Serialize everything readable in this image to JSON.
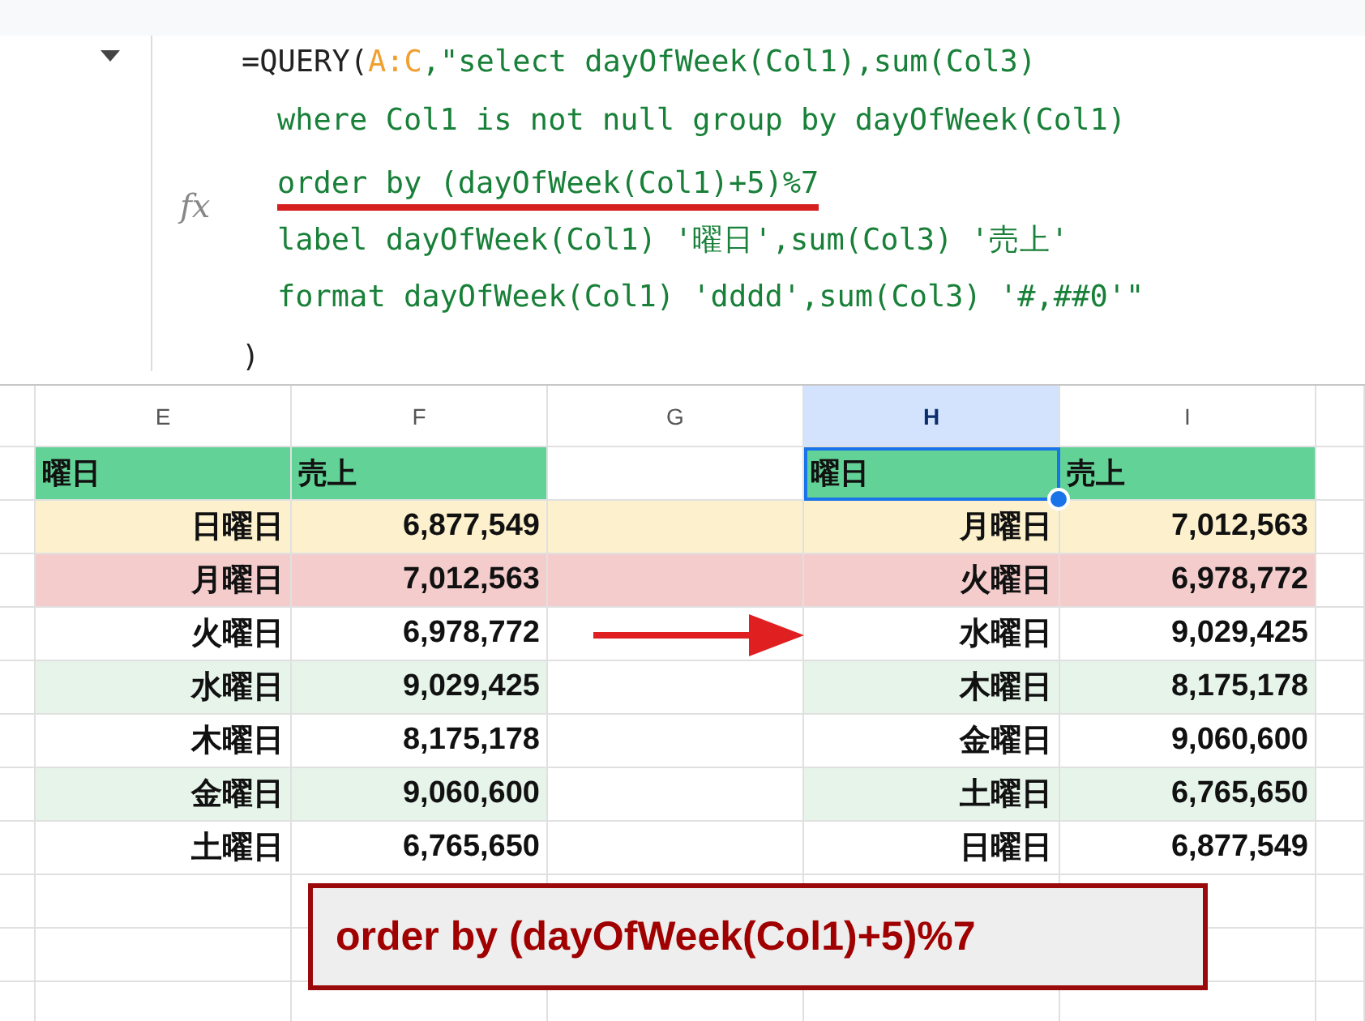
{
  "formula_bar": {
    "fx_label": "fx",
    "lines": [
      {
        "underlined": false,
        "segments": [
          {
            "kind": "plain",
            "text": "=QUERY("
          },
          {
            "kind": "range",
            "text": "A:C"
          },
          {
            "kind": "string",
            "text": ",\"select dayOfWeek(Col1),sum(Col3)"
          }
        ]
      },
      {
        "underlined": false,
        "segments": [
          {
            "kind": "string",
            "text": "where Col1 is not null group by dayOfWeek(Col1)"
          }
        ]
      },
      {
        "underlined": true,
        "segments": [
          {
            "kind": "string",
            "text": "order by (dayOfWeek(Col1)+5)%7"
          }
        ]
      },
      {
        "underlined": false,
        "segments": [
          {
            "kind": "string",
            "text": "label dayOfWeek(Col1) '曜日',sum(Col3) '売上'"
          }
        ]
      },
      {
        "underlined": false,
        "segments": [
          {
            "kind": "string",
            "text": "format dayOfWeek(Col1) 'dddd',sum(Col3) '#,##0'\""
          }
        ]
      },
      {
        "underlined": false,
        "segments": [
          {
            "kind": "plain",
            "text": ")"
          }
        ]
      }
    ]
  },
  "columns": [
    {
      "label": "E",
      "selected": false
    },
    {
      "label": "F",
      "selected": false
    },
    {
      "label": "G",
      "selected": false
    },
    {
      "label": "H",
      "selected": true
    },
    {
      "label": "I",
      "selected": false
    }
  ],
  "header_row": {
    "cells": [
      {
        "text": "曜日",
        "selected": false
      },
      {
        "text": "売上",
        "selected": false
      },
      {
        "text": "曜日",
        "selected": true
      },
      {
        "text": "売上",
        "selected": false
      }
    ]
  },
  "rows": [
    {
      "cells": [
        "日曜日",
        "6,877,549",
        "月曜日",
        "7,012,563"
      ],
      "color": "#fdf0cd",
      "gap_filled": true
    },
    {
      "cells": [
        "月曜日",
        "7,012,563",
        "火曜日",
        "6,978,772"
      ],
      "color": "#f4cccc",
      "gap_filled": true
    },
    {
      "cells": [
        "火曜日",
        "6,978,772",
        "水曜日",
        "9,029,425"
      ],
      "color": "#ffffff",
      "gap_filled": false
    },
    {
      "cells": [
        "水曜日",
        "9,029,425",
        "木曜日",
        "8,175,178"
      ],
      "color": "#e6f4ea",
      "gap_filled": false
    },
    {
      "cells": [
        "木曜日",
        "8,175,178",
        "金曜日",
        "9,060,600"
      ],
      "color": "#ffffff",
      "gap_filled": false
    },
    {
      "cells": [
        "金曜日",
        "9,060,600",
        "土曜日",
        "6,765,650"
      ],
      "color": "#e6f4ea",
      "gap_filled": false
    },
    {
      "cells": [
        "土曜日",
        "6,765,650",
        "日曜日",
        "6,877,549"
      ],
      "color": "#ffffff",
      "gap_filled": false
    }
  ],
  "callout": {
    "text": "order by (dayOfWeek(Col1)+5)%7"
  }
}
